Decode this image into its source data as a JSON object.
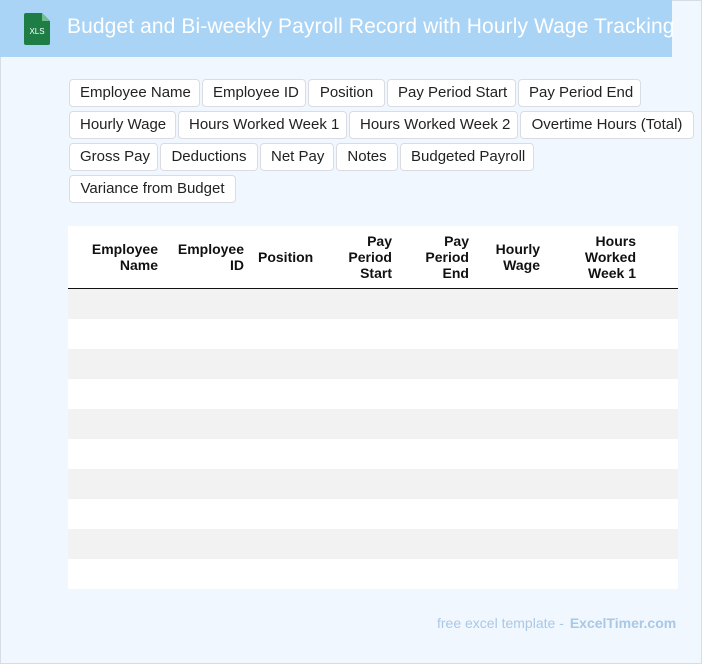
{
  "header": {
    "title": "Budget and Bi-weekly Payroll Record with Hourly Wage Tracking",
    "icon_label": "XLS",
    "icon": "excel-file-icon",
    "colors": {
      "banner": "#a9d4f5",
      "icon": "#1e7d45"
    }
  },
  "fields": [
    "Employee Name",
    "Employee ID",
    "Position",
    "Pay Period Start",
    "Pay Period End",
    "Hourly Wage",
    "Hours Worked Week 1",
    "Hours Worked Week 2",
    "Overtime Hours (Total)",
    "Gross Pay",
    "Deductions",
    "Net Pay",
    "Notes",
    "Budgeted Payroll",
    "Variance from Budget"
  ],
  "table": {
    "columns": [
      {
        "label": "Employee Name"
      },
      {
        "label": "Employee ID"
      },
      {
        "label": "Position"
      },
      {
        "label": "Pay Period Start"
      },
      {
        "label": "Pay Period End"
      },
      {
        "label": "Hourly Wage"
      },
      {
        "label": "Hours Worked Week 1"
      }
    ],
    "row_count": 10
  },
  "footer": {
    "text": "free excel template -",
    "brand": "ExcelTimer.com"
  }
}
